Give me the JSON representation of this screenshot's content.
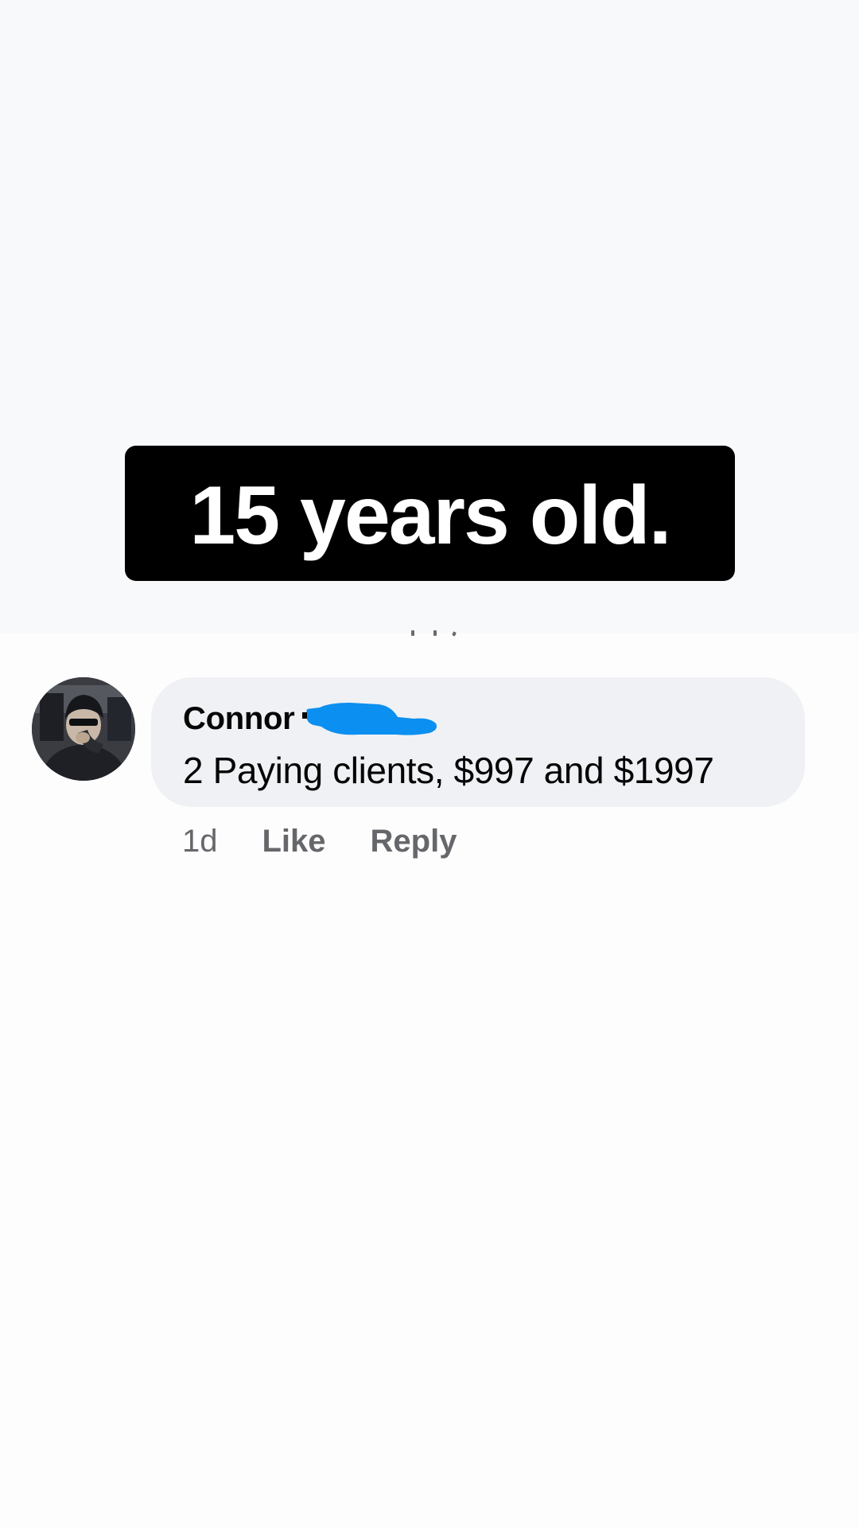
{
  "caption": {
    "text": "15 years old."
  },
  "comment": {
    "author": "Connor",
    "author_redacted": true,
    "redaction_color": "#0b8ff0",
    "text": "2 Paying clients, $997 and $1997",
    "timestamp": "1d",
    "like_label": "Like",
    "reply_label": "Reply",
    "bubble_color": "#eff1f4"
  },
  "colors": {
    "caption_background": "#000000",
    "caption_text": "#ffffff",
    "meta_text": "#65676b",
    "body_text": "#050505"
  }
}
